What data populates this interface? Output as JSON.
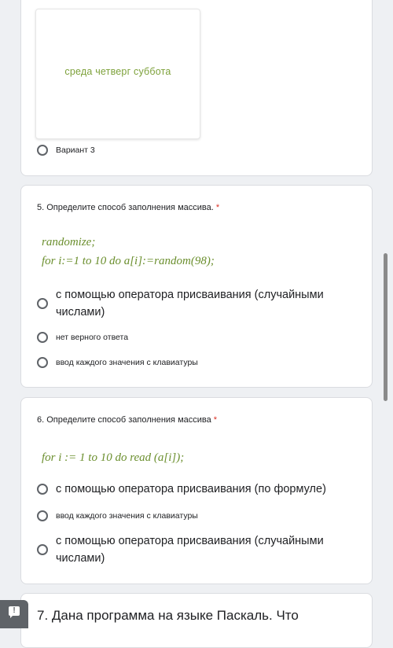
{
  "top_card": {
    "image_days": "среда  четверг  суббота",
    "option_variant3": "Вариант 3"
  },
  "q5": {
    "title": "5. Определите способ заполнения массива.",
    "required_mark": "*",
    "formula_line1": "randomize;",
    "formula_line2": "for i:=1 to 10 do a[i]:=random(98);",
    "options": [
      "с помощью оператора присваивания (случайными числами)",
      "нет верного ответа",
      "ввод каждого значения с клавиатуры"
    ]
  },
  "q6": {
    "title": "6. Определите способ заполнения массива",
    "required_mark": "*",
    "formula": "for i := 1 to 10 do read (a[i]);",
    "options": [
      "с помощью оператора присваивания (по формуле)",
      "ввод каждого значения с клавиатуры",
      "с помощью оператора присваивания (случайными числами)"
    ]
  },
  "q7": {
    "title": "7. Дана программа на языке Паскаль. Что"
  },
  "feedback": {
    "icon": "report-feedback-icon",
    "glyph": "!"
  }
}
